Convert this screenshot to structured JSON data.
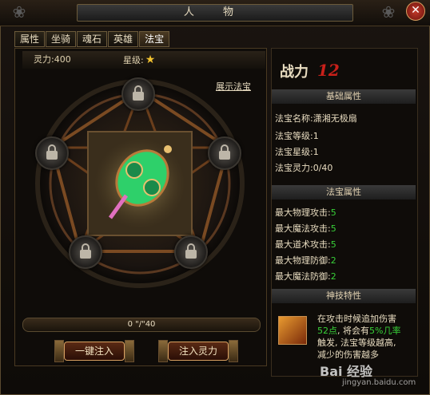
{
  "window": {
    "title": "人 物",
    "close_label": "✕"
  },
  "tabs": [
    {
      "label": "属性",
      "active": false
    },
    {
      "label": "坐骑",
      "active": false
    },
    {
      "label": "魂石",
      "active": false
    },
    {
      "label": "英雄",
      "active": false
    },
    {
      "label": "法宝",
      "active": true
    }
  ],
  "stats": {
    "lingli": "灵力:400",
    "star_label": "星级:",
    "star_icon": "★"
  },
  "show_treasure_link": "展示法宝",
  "progress": {
    "text": "0 \"/\"40",
    "value": 0,
    "max": 40
  },
  "buttons": {
    "inject_all": "一键注入",
    "inject_spirit": "注入灵力"
  },
  "power": {
    "label": "战力",
    "value": "12"
  },
  "basic_attrs": {
    "header": "基础属性",
    "rows": [
      {
        "label": "法宝名称:",
        "value": "潇湘无极扇"
      },
      {
        "label": "法宝等级:",
        "value": "1"
      },
      {
        "label": "法宝星级:",
        "value": "1"
      },
      {
        "label": "法宝灵力:",
        "value": "0/40"
      }
    ]
  },
  "treasure_attrs": {
    "header": "法宝属性",
    "rows": [
      {
        "label": "最大物理攻击:",
        "value": "5"
      },
      {
        "label": "最大魔法攻击:",
        "value": "5"
      },
      {
        "label": "最大道术攻击:",
        "value": "5"
      },
      {
        "label": "最大物理防御:",
        "value": "2"
      },
      {
        "label": "最大魔法防御:",
        "value": "2"
      }
    ]
  },
  "skill": {
    "header": "神技特性",
    "line1": "在攻击时候追加伤害",
    "line2a": "52点",
    "line2b": ", 将会有",
    "line2c": "5%几率",
    "line3": "触发, 法宝等级越高,",
    "line4": "减少的伤害越多"
  },
  "watermark": {
    "brand": "Bai 经验",
    "url": "jingyan.baidu.com"
  },
  "colors": {
    "accent_red": "#c8201a",
    "green": "#38d038",
    "gold": "#d8a060"
  }
}
